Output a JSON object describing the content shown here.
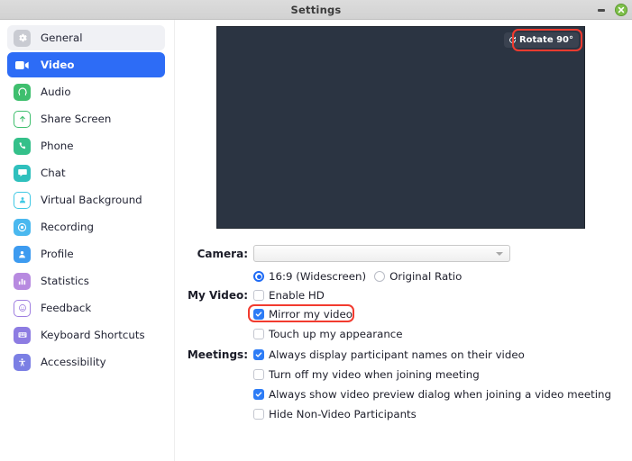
{
  "window": {
    "title": "Settings",
    "minimize_icon": "minimize-icon",
    "close_icon": "close-icon"
  },
  "sidebar": {
    "items": [
      {
        "label": "General",
        "icon": "gear-icon",
        "state": "hovered",
        "color": "#c9cbd2"
      },
      {
        "label": "Video",
        "icon": "video-camera-icon",
        "state": "active",
        "color": "#2d6cf6"
      },
      {
        "label": "Audio",
        "icon": "headphones-icon",
        "state": "normal",
        "color": "#3fbf6e"
      },
      {
        "label": "Share Screen",
        "icon": "share-screen-icon",
        "state": "normal",
        "color": "#3fbf6e"
      },
      {
        "label": "Phone",
        "icon": "phone-icon",
        "state": "normal",
        "color": "#34c08a"
      },
      {
        "label": "Chat",
        "icon": "chat-bubble-icon",
        "state": "normal",
        "color": "#2fc0bd"
      },
      {
        "label": "Virtual Background",
        "icon": "virtual-background-icon",
        "state": "normal",
        "color": "#3fc8e4"
      },
      {
        "label": "Recording",
        "icon": "record-icon",
        "state": "normal",
        "color": "#4ab8ef"
      },
      {
        "label": "Profile",
        "icon": "person-icon",
        "state": "normal",
        "color": "#3d9bf0"
      },
      {
        "label": "Statistics",
        "icon": "bar-chart-icon",
        "state": "normal",
        "color": "#b78ae0"
      },
      {
        "label": "Feedback",
        "icon": "smiley-icon",
        "state": "normal",
        "color": "#9f7fe0"
      },
      {
        "label": "Keyboard Shortcuts",
        "icon": "keyboard-icon",
        "state": "normal",
        "color": "#8d7ce2"
      },
      {
        "label": "Accessibility",
        "icon": "accessibility-icon",
        "state": "normal",
        "color": "#7b7fe4"
      }
    ]
  },
  "main": {
    "preview": {
      "rotate_label": "Rotate 90°",
      "rotate_icon": "rotate-icon",
      "background_color": "#2b3442",
      "highlight_color": "#f23b2f"
    },
    "camera": {
      "label": "Camera:",
      "value": "",
      "placeholder": ""
    },
    "aspect_ratio": {
      "options": [
        {
          "label": "16:9 (Widescreen)",
          "selected": true
        },
        {
          "label": "Original Ratio",
          "selected": false
        }
      ]
    },
    "my_video": {
      "label": "My Video:",
      "options": [
        {
          "label": "Enable HD",
          "checked": false,
          "highlighted": false
        },
        {
          "label": "Mirror my video",
          "checked": true,
          "highlighted": true
        },
        {
          "label": "Touch up my appearance",
          "checked": false,
          "highlighted": false
        }
      ]
    },
    "meetings": {
      "label": "Meetings:",
      "options": [
        {
          "label": "Always display participant names on their video",
          "checked": true
        },
        {
          "label": "Turn off my video when joining meeting",
          "checked": false
        },
        {
          "label": "Always show video preview dialog when joining a video meeting",
          "checked": true
        },
        {
          "label": "Hide Non-Video Participants",
          "checked": false
        }
      ]
    }
  }
}
